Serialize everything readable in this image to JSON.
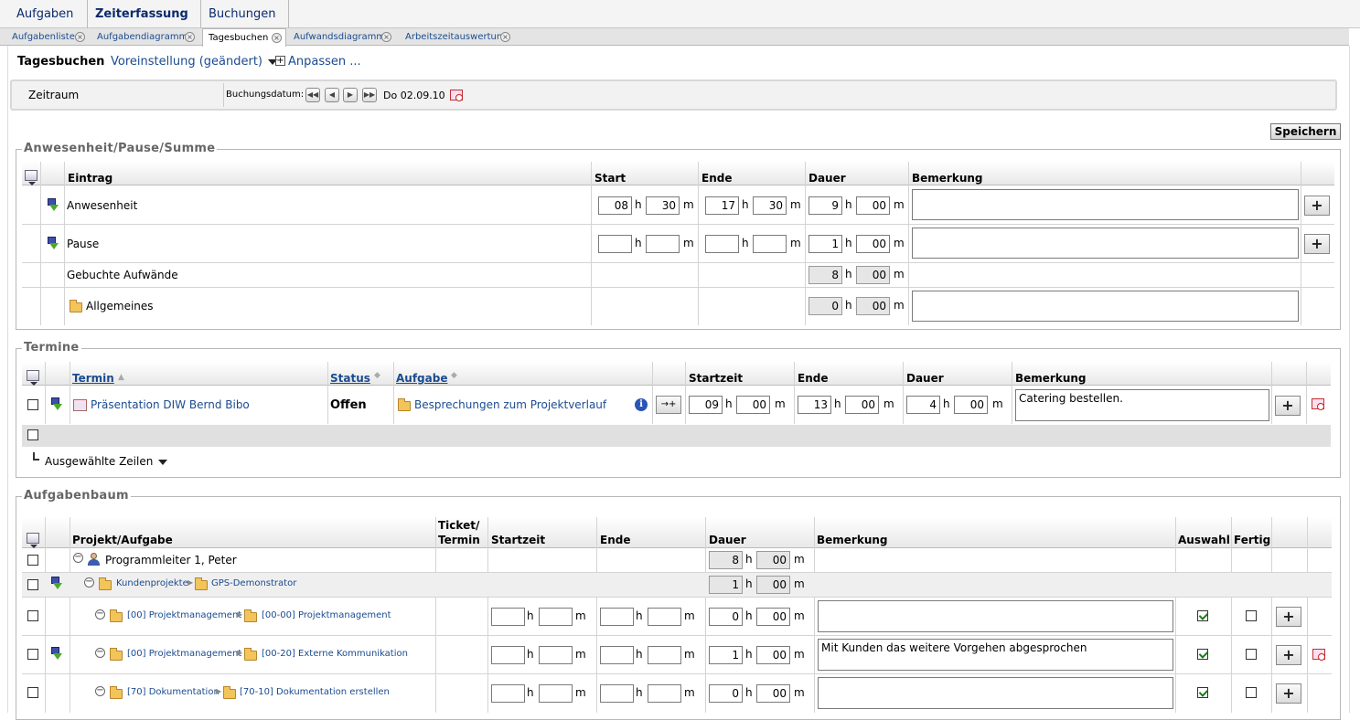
{
  "menubar": {
    "items": [
      {
        "label": "Aufgaben",
        "bold": false
      },
      {
        "label": "Zeiterfassung",
        "bold": true
      },
      {
        "label": "Buchungen",
        "bold": false
      }
    ]
  },
  "tabs": [
    {
      "label": "Aufgabenliste",
      "active": false
    },
    {
      "label": "Aufgabendiagramm",
      "active": false
    },
    {
      "label": "Tagesbuchen",
      "active": true
    },
    {
      "label": "Aufwandsdiagramm",
      "active": false
    },
    {
      "label": "Arbeitszeitauswertung",
      "active": false
    }
  ],
  "toolbar": {
    "title": "Tagesbuchen",
    "preset": "Voreinstellung (geändert)",
    "customize": "Anpassen ..."
  },
  "filter": {
    "zeitraum_label": "Zeitraum",
    "buchungsdatum_label": "Buchungsdatum:",
    "date": "Do 02.09.10"
  },
  "save_label": "Speichern",
  "units": {
    "h": "h",
    "m": "m"
  },
  "anwesenheit": {
    "legend": "Anwesenheit/Pause/Summe",
    "headers": {
      "eintrag": "Eintrag",
      "start": "Start",
      "ende": "Ende",
      "dauer": "Dauer",
      "bemerkung": "Bemerkung"
    },
    "rows": [
      {
        "label": "Anwesenheit",
        "start_h": "08",
        "start_m": "30",
        "ende_h": "17",
        "ende_m": "30",
        "dauer_h": "9",
        "dauer_m": "00",
        "bemerkung": ""
      },
      {
        "label": "Pause",
        "start_h": "",
        "start_m": "",
        "ende_h": "",
        "ende_m": "",
        "dauer_h": "1",
        "dauer_m": "00",
        "bemerkung": ""
      },
      {
        "label": "Gebuchte Aufwände",
        "dauer_h": "8",
        "dauer_m": "00"
      },
      {
        "label": "Allgemeines",
        "dauer_h": "0",
        "dauer_m": "00",
        "bemerkung": ""
      }
    ]
  },
  "termine": {
    "legend": "Termine",
    "headers": {
      "termin": "Termin",
      "status": "Status",
      "aufgabe": "Aufgabe",
      "startzeit": "Startzeit",
      "ende": "Ende",
      "dauer": "Dauer",
      "bemerkung": "Bemerkung"
    },
    "rows": [
      {
        "termin": "Präsentation DIW Bernd Bibo",
        "status": "Offen",
        "aufgabe": "Besprechungen zum Projektverlauf",
        "start_h": "09",
        "start_m": "00",
        "ende_h": "13",
        "ende_m": "00",
        "dauer_h": "4",
        "dauer_m": "00",
        "bemerkung": "Catering bestellen.",
        "action": "→+"
      }
    ],
    "selected_rows_label": "Ausgewählte Zeilen"
  },
  "aufgabenbaum": {
    "legend": "Aufgabenbaum",
    "headers": {
      "projekt": "Projekt/Aufgabe",
      "ticket": "Ticket/",
      "termin": "Termin",
      "startzeit": "Startzeit",
      "ende": "Ende",
      "dauer": "Dauer",
      "bemerkung": "Bemerkung",
      "auswahl": "Auswahl",
      "fertig": "Fertig"
    },
    "rows": [
      {
        "name": "Programmleiter 1, Peter",
        "dauer_h": "8",
        "dauer_m": "00"
      },
      {
        "parent": "Kundenprojekte",
        "name": "GPS-Demonstrator",
        "dauer_h": "1",
        "dauer_m": "00"
      },
      {
        "parent": "[00] Projektmanagement",
        "name": "[00-00] Projektmanagement",
        "dauer_h": "0",
        "dauer_m": "00",
        "bemerkung": "",
        "auswahl": true,
        "fertig": false
      },
      {
        "parent": "[00] Projektmanagement",
        "name": "[00-20] Externe Kommunikation",
        "dauer_h": "1",
        "dauer_m": "00",
        "bemerkung": "Mit Kunden das weitere Vorgehen abgesprochen",
        "auswahl": true,
        "fertig": false
      },
      {
        "parent": "[70] Dokumentation",
        "name": "[70-10] Dokumentation erstellen",
        "dauer_h": "0",
        "dauer_m": "00",
        "bemerkung": "",
        "auswahl": true,
        "fertig": false
      }
    ]
  },
  "icons": [
    "download-icon",
    "folder-icon",
    "person-icon",
    "calendar-icon",
    "info-icon",
    "table-menu-icon",
    "collapse-icon",
    "close-tab-icon",
    "plus-icon",
    "calendar-clock-icon"
  ]
}
